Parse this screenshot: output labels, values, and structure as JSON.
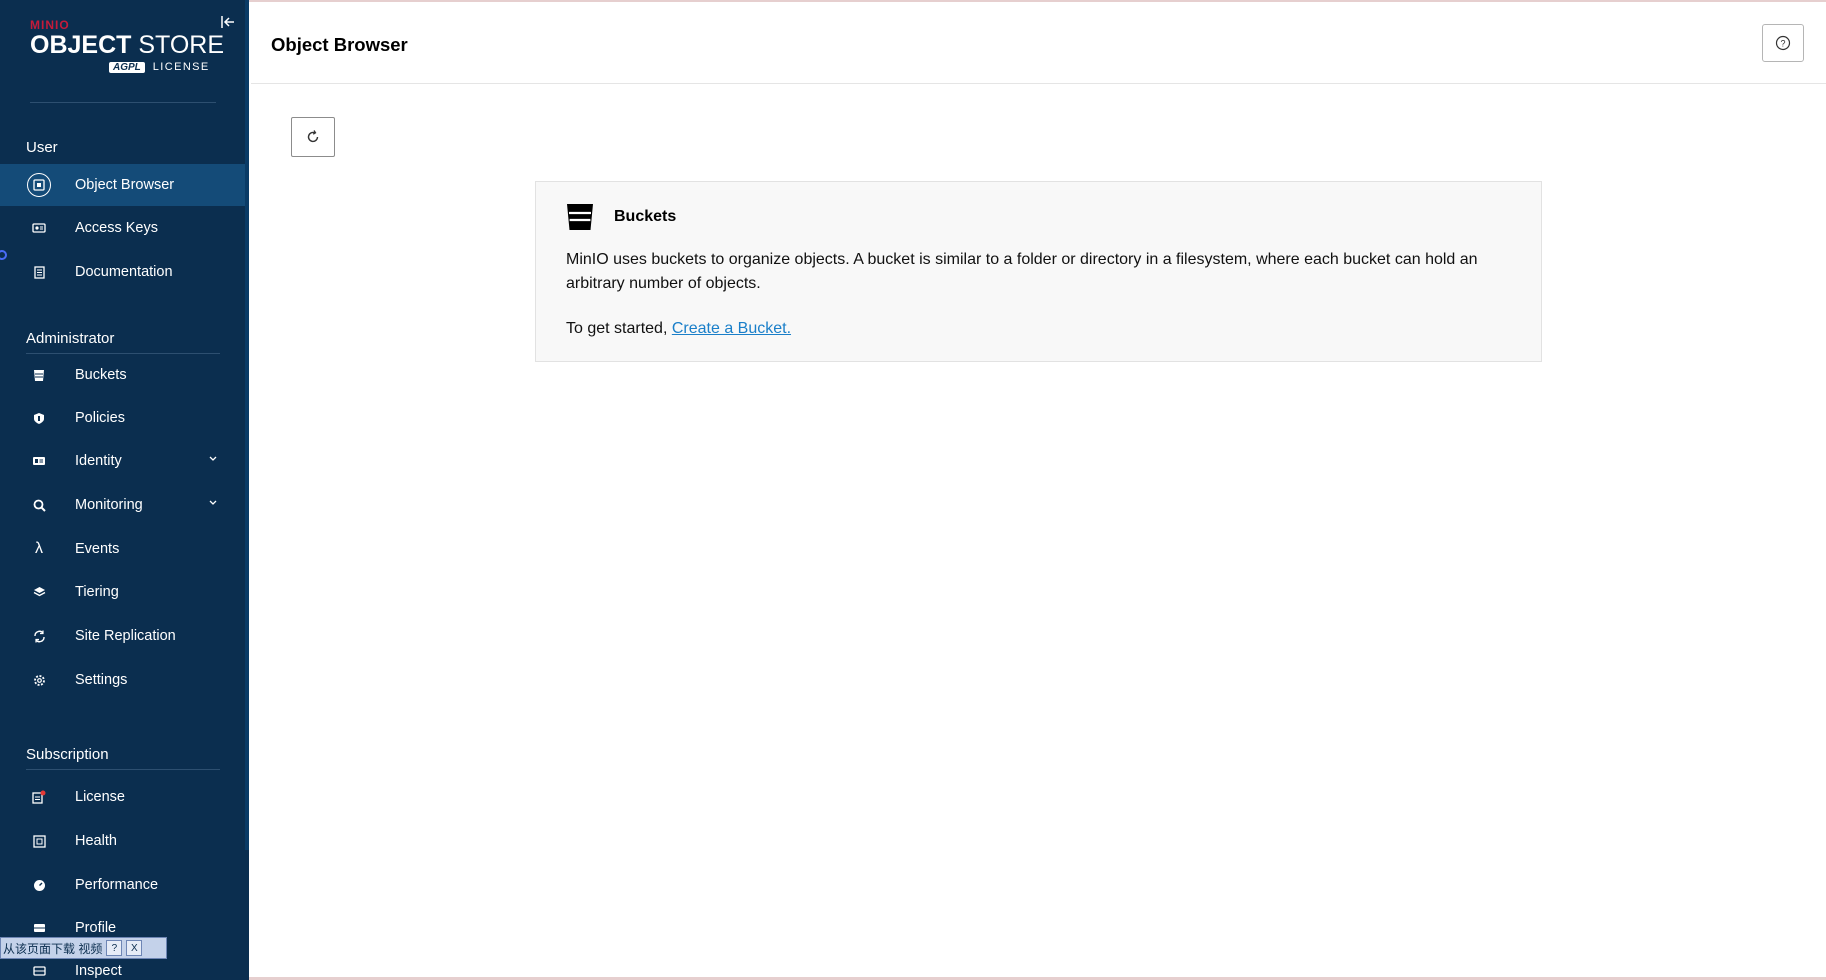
{
  "sidebar": {
    "logo": {
      "brand": "MINIO",
      "title_bold": "OBJECT",
      "title_rest": " STORE",
      "badge": "AGPL",
      "license": "LICENSE"
    },
    "sections": [
      {
        "label": "User"
      },
      {
        "label": "Administrator"
      },
      {
        "label": "Subscription"
      }
    ],
    "items": [
      {
        "label": "Object Browser",
        "icon": "object-browser-icon"
      },
      {
        "label": "Access Keys",
        "icon": "access-keys-icon"
      },
      {
        "label": "Documentation",
        "icon": "documentation-icon"
      },
      {
        "label": "Buckets",
        "icon": "bucket-icon"
      },
      {
        "label": "Policies",
        "icon": "policy-icon"
      },
      {
        "label": "Identity",
        "icon": "identity-icon"
      },
      {
        "label": "Monitoring",
        "icon": "monitoring-icon"
      },
      {
        "label": "Events",
        "icon": "lambda-icon"
      },
      {
        "label": "Tiering",
        "icon": "tiering-icon"
      },
      {
        "label": "Site Replication",
        "icon": "replication-icon"
      },
      {
        "label": "Settings",
        "icon": "gear-icon"
      },
      {
        "label": "License",
        "icon": "license-icon"
      },
      {
        "label": "Health",
        "icon": "health-icon"
      },
      {
        "label": "Performance",
        "icon": "performance-icon"
      },
      {
        "label": "Profile",
        "icon": "profile-icon"
      },
      {
        "label": "Inspect",
        "icon": "inspect-icon"
      }
    ],
    "ime_toolbar": {
      "text": "从该页面下载 视频",
      "help": "?",
      "close": "X"
    }
  },
  "header": {
    "title": "Object Browser"
  },
  "empty_state": {
    "title": "Buckets",
    "description": "MinIO uses buckets to organize objects. A bucket is similar to a folder or directory in a filesystem, where each bucket can hold an arbitrary number of objects.",
    "cta_prefix": "To get started, ",
    "cta_link": "Create a Bucket."
  },
  "colors": {
    "sidebar_bg": "#0b2e4f",
    "active_item": "#144b78",
    "link": "#1a7fc9",
    "brand_red": "#c51b3a"
  }
}
